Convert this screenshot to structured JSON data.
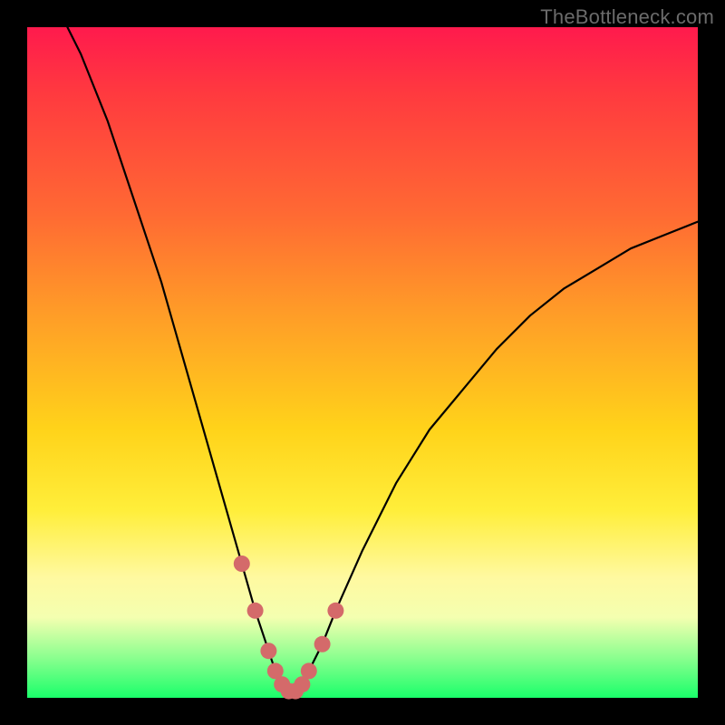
{
  "watermark": "TheBottleneck.com",
  "colors": {
    "curve": "#000000",
    "markers": "#d46a6a",
    "gradient_top": "#ff1a4d",
    "gradient_bottom": "#1aff6a"
  },
  "chart_data": {
    "type": "line",
    "title": "",
    "xlabel": "",
    "ylabel": "",
    "xlim": [
      0,
      100
    ],
    "ylim": [
      0,
      100
    ],
    "grid": false,
    "series": [
      {
        "name": "bottleneck-curve",
        "x": [
          6,
          8,
          10,
          12,
          14,
          16,
          18,
          20,
          22,
          24,
          26,
          28,
          30,
          32,
          34,
          36,
          37,
          38,
          39,
          40,
          41,
          42,
          44,
          46,
          50,
          55,
          60,
          65,
          70,
          75,
          80,
          85,
          90,
          95,
          100
        ],
        "values": [
          100,
          96,
          91,
          86,
          80,
          74,
          68,
          62,
          55,
          48,
          41,
          34,
          27,
          20,
          13,
          7,
          4,
          2,
          1,
          1,
          2,
          4,
          8,
          13,
          22,
          32,
          40,
          46,
          52,
          57,
          61,
          64,
          67,
          69,
          71
        ]
      }
    ],
    "markers": {
      "name": "highlight-points",
      "x": [
        32,
        34,
        36,
        37,
        38,
        39,
        40,
        41,
        42,
        44,
        46
      ],
      "values": [
        20,
        13,
        7,
        4,
        2,
        1,
        1,
        2,
        4,
        8,
        13
      ]
    }
  }
}
